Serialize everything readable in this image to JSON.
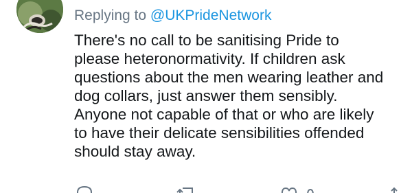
{
  "reply": {
    "prefix": "Replying to ",
    "handle": "@UKPrideNetwork"
  },
  "tweet": {
    "lines": [
      "There's no call to be sanitising Pride to",
      "please heteronormativity. If children ask",
      "questions about the men wearing leather and",
      "dog collars, just answer them sensibly.",
      "Anyone not capable of that or who are likely",
      "to have their delicate sensibilities offended",
      "should stay away."
    ]
  },
  "actions": {
    "reply_icon": "comment-icon",
    "retweet_icon": "retweet-icon",
    "like_icon": "heart-icon",
    "share_icon": "share-icon"
  },
  "colors": {
    "text": "#14171a",
    "secondary": "#687684",
    "link": "#1b95e0"
  }
}
